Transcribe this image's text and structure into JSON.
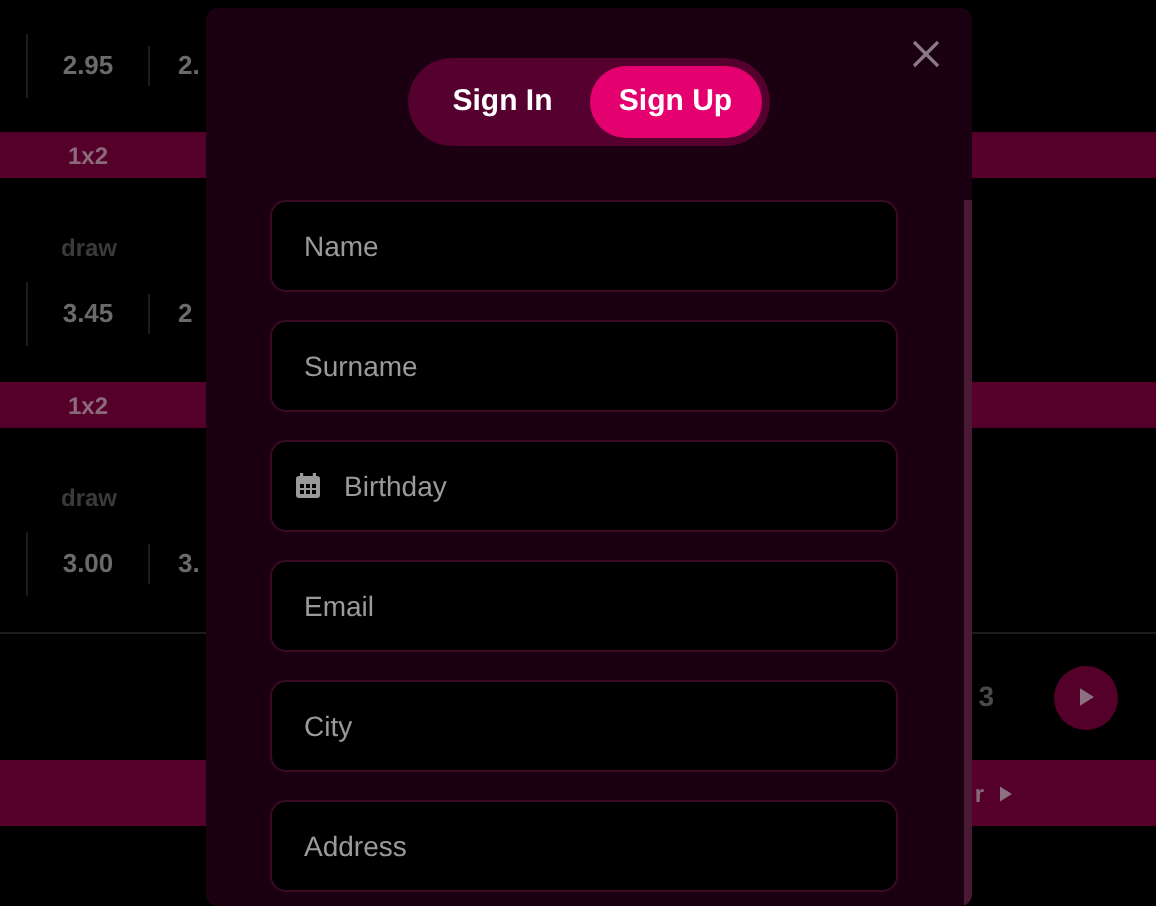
{
  "background": {
    "odds_rows": [
      {
        "label": "",
        "values": [
          "2.95",
          "2."
        ]
      },
      {
        "band": "1x2",
        "label": "draw",
        "values": [
          "3.45",
          "2"
        ]
      },
      {
        "band": "1x2",
        "label": "draw",
        "values": [
          "3.00",
          "3."
        ]
      }
    ],
    "side_text": "3",
    "bottom_band_text": "r"
  },
  "modal": {
    "tabs": [
      {
        "label": "Sign In",
        "selected": false
      },
      {
        "label": "Sign Up",
        "selected": true
      }
    ],
    "fields": [
      {
        "placeholder": "Name",
        "kind": "text"
      },
      {
        "placeholder": "Surname",
        "kind": "text"
      },
      {
        "placeholder": "Birthday",
        "kind": "date"
      },
      {
        "placeholder": "Email",
        "kind": "text"
      },
      {
        "placeholder": "City",
        "kind": "text"
      },
      {
        "placeholder": "Address",
        "kind": "text"
      }
    ]
  }
}
